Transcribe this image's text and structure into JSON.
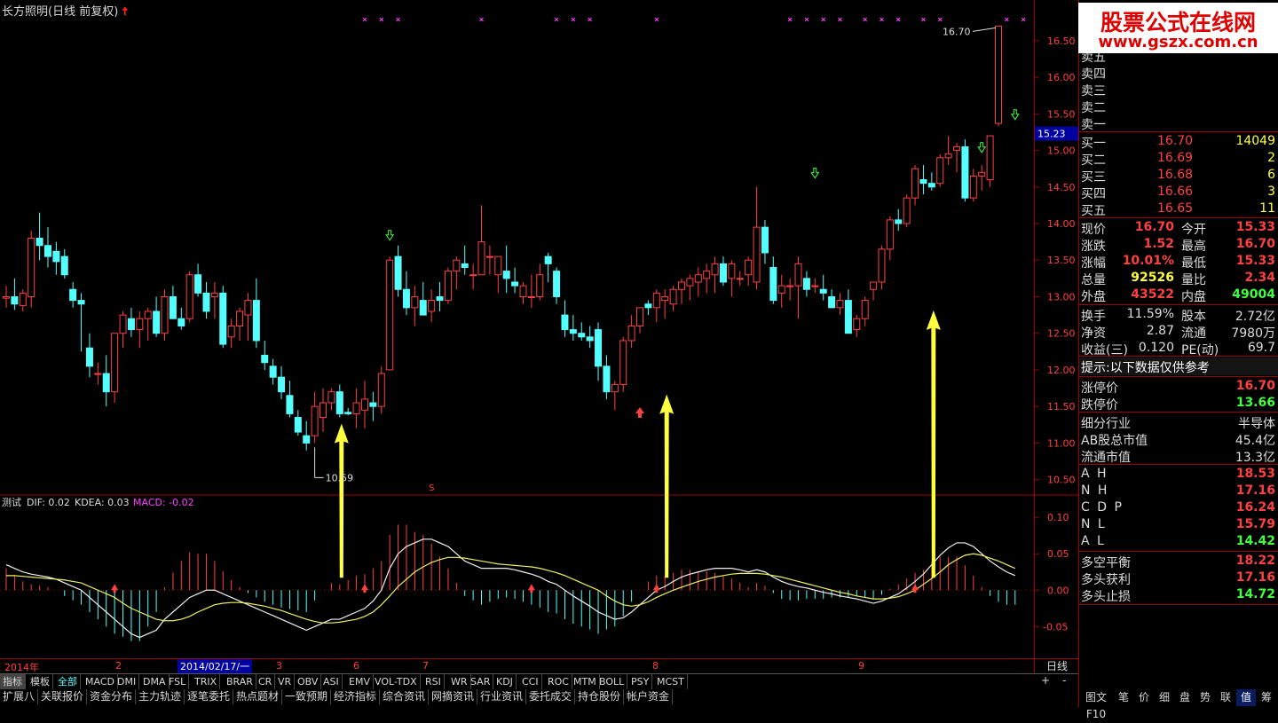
{
  "window_title": "长方照明(日线 前复权)",
  "price_axis": {
    "labels": [
      "16.50",
      "16.00",
      "15.50",
      "15.00",
      "14.50",
      "14.00",
      "13.50",
      "13.00",
      "12.50",
      "12.00",
      "11.50",
      "11.00",
      "10.50"
    ],
    "current_price_tag": "15.23",
    "high_label": "16.70",
    "low_label": "10.59",
    "s_marker": "S"
  },
  "indicator": {
    "name": "测试",
    "dif_text": "DIF: 0.02",
    "kdea_text": "KDEA: 0.03",
    "macd_text": "MACD: -0.02",
    "axis_labels": [
      "0.10",
      "0.05",
      "0.00",
      "-0.05"
    ]
  },
  "time_axis": {
    "labels": [
      "2014年",
      "2",
      "2014/02/17/一",
      "3",
      "6",
      "7",
      "8",
      "9"
    ],
    "period": "日线",
    "plus": "+",
    "minus": "-"
  },
  "chart_data": {
    "type": "candlestick",
    "ylim": [
      10.35,
      16.85
    ],
    "candles": [
      [
        12.98,
        13.15,
        12.85,
        13.0
      ],
      [
        13.0,
        13.25,
        12.82,
        12.9
      ],
      [
        12.88,
        13.1,
        12.8,
        13.05
      ],
      [
        13.0,
        13.9,
        12.85,
        13.8
      ],
      [
        13.8,
        14.15,
        13.5,
        13.7
      ],
      [
        13.7,
        13.95,
        13.4,
        13.55
      ],
      [
        13.62,
        13.75,
        13.3,
        13.48
      ],
      [
        13.55,
        13.65,
        13.25,
        13.3
      ],
      [
        13.1,
        13.2,
        12.85,
        12.95
      ],
      [
        12.95,
        13.05,
        12.25,
        12.9
      ],
      [
        12.3,
        12.5,
        11.9,
        12.05
      ],
      [
        11.95,
        12.1,
        11.8,
        11.95
      ],
      [
        11.95,
        12.2,
        11.5,
        11.7
      ],
      [
        11.7,
        12.2,
        11.55,
        12.5
      ],
      [
        12.5,
        12.8,
        12.3,
        12.75
      ],
      [
        12.7,
        12.85,
        12.45,
        12.55
      ],
      [
        12.55,
        12.8,
        12.3,
        12.7
      ],
      [
        12.7,
        12.85,
        12.4,
        12.8
      ],
      [
        12.8,
        13.0,
        12.45,
        12.5
      ],
      [
        12.5,
        13.1,
        12.4,
        13.0
      ],
      [
        13.0,
        13.15,
        12.75,
        12.7
      ],
      [
        12.7,
        12.85,
        12.55,
        12.6
      ],
      [
        12.7,
        13.35,
        12.65,
        13.3
      ],
      [
        13.3,
        13.45,
        13.0,
        13.05
      ],
      [
        13.05,
        13.2,
        12.7,
        12.8
      ],
      [
        13.0,
        13.2,
        12.7,
        13.05
      ],
      [
        13.05,
        13.15,
        12.3,
        12.35
      ],
      [
        12.45,
        12.7,
        12.3,
        12.6
      ],
      [
        12.6,
        12.85,
        12.4,
        12.8
      ],
      [
        12.75,
        13.05,
        12.4,
        12.95
      ],
      [
        12.95,
        13.25,
        12.3,
        12.4
      ],
      [
        12.2,
        12.4,
        12.0,
        12.1
      ],
      [
        12.05,
        12.15,
        11.8,
        11.9
      ],
      [
        11.9,
        12.05,
        11.6,
        11.7
      ],
      [
        11.65,
        11.85,
        11.35,
        11.4
      ],
      [
        11.35,
        11.45,
        11.1,
        11.15
      ],
      [
        11.1,
        11.3,
        10.9,
        11.0
      ],
      [
        11.1,
        11.7,
        11.0,
        11.5
      ],
      [
        11.35,
        11.75,
        11.15,
        11.55
      ],
      [
        11.55,
        11.75,
        11.45,
        11.7
      ],
      [
        11.7,
        11.8,
        11.35,
        11.4
      ],
      [
        11.42,
        11.48,
        11.38,
        11.4
      ],
      [
        11.4,
        11.75,
        11.2,
        11.55
      ],
      [
        11.45,
        11.85,
        11.2,
        11.6
      ],
      [
        11.55,
        11.7,
        11.3,
        11.5
      ],
      [
        11.5,
        12.05,
        11.4,
        11.95
      ],
      [
        12.0,
        13.55,
        12.0,
        13.5
      ],
      [
        13.55,
        13.7,
        13.0,
        13.1
      ],
      [
        13.1,
        13.35,
        12.75,
        12.85
      ],
      [
        12.85,
        13.15,
        12.6,
        13.0
      ],
      [
        12.95,
        13.2,
        12.75,
        12.75
      ],
      [
        12.8,
        13.1,
        12.65,
        12.95
      ],
      [
        13.0,
        13.2,
        12.8,
        12.95
      ],
      [
        12.95,
        13.4,
        12.9,
        13.35
      ],
      [
        13.35,
        13.55,
        13.1,
        13.5
      ],
      [
        13.45,
        13.7,
        13.3,
        13.4
      ],
      [
        13.3,
        13.45,
        13.1,
        13.3
      ],
      [
        13.3,
        14.25,
        13.3,
        13.75
      ],
      [
        13.55,
        13.7,
        13.3,
        13.55
      ],
      [
        13.3,
        13.55,
        13.05,
        13.55
      ],
      [
        13.35,
        13.7,
        13.05,
        13.25
      ],
      [
        13.2,
        13.4,
        13.05,
        13.15
      ],
      [
        13.0,
        13.2,
        12.9,
        13.15
      ],
      [
        13.0,
        13.3,
        12.85,
        13.0
      ],
      [
        13.0,
        13.45,
        12.95,
        13.3
      ],
      [
        13.55,
        13.6,
        13.2,
        13.45
      ],
      [
        13.35,
        13.4,
        12.9,
        13.0
      ],
      [
        12.75,
        12.95,
        12.45,
        12.55
      ],
      [
        12.55,
        12.75,
        12.4,
        12.5
      ],
      [
        12.5,
        12.65,
        12.4,
        12.45
      ],
      [
        12.45,
        12.6,
        12.3,
        12.4
      ],
      [
        12.55,
        12.65,
        11.85,
        12.05
      ],
      [
        12.05,
        12.2,
        11.6,
        11.7
      ],
      [
        11.7,
        11.85,
        11.45,
        11.8
      ],
      [
        11.8,
        12.45,
        11.7,
        12.4
      ],
      [
        12.4,
        12.75,
        12.3,
        12.6
      ],
      [
        12.6,
        12.85,
        12.5,
        12.85
      ],
      [
        12.9,
        12.95,
        12.75,
        12.85
      ],
      [
        12.85,
        13.1,
        12.65,
        13.05
      ],
      [
        12.95,
        13.1,
        12.7,
        13.0
      ],
      [
        12.9,
        13.15,
        12.8,
        13.1
      ],
      [
        13.1,
        13.25,
        12.9,
        13.2
      ],
      [
        13.15,
        13.3,
        12.95,
        13.25
      ],
      [
        13.2,
        13.4,
        13.0,
        13.3
      ],
      [
        13.25,
        13.45,
        13.05,
        13.35
      ],
      [
        13.3,
        13.55,
        13.05,
        13.45
      ],
      [
        13.45,
        13.55,
        13.15,
        13.2
      ],
      [
        13.25,
        13.5,
        13.0,
        13.45
      ],
      [
        13.25,
        13.35,
        13.15,
        13.25
      ],
      [
        13.3,
        13.55,
        13.15,
        13.5
      ],
      [
        13.2,
        14.5,
        13.1,
        13.95
      ],
      [
        13.95,
        14.05,
        13.45,
        13.6
      ],
      [
        13.4,
        13.55,
        12.9,
        12.95
      ],
      [
        13.05,
        13.3,
        12.85,
        13.15
      ],
      [
        13.15,
        13.25,
        12.95,
        13.15
      ],
      [
        13.15,
        13.55,
        12.7,
        13.45
      ],
      [
        13.25,
        13.35,
        13.0,
        13.1
      ],
      [
        13.15,
        13.25,
        13.05,
        13.15
      ],
      [
        13.1,
        13.3,
        12.95,
        13.05
      ],
      [
        13.0,
        13.1,
        12.85,
        12.85
      ],
      [
        12.85,
        13.05,
        12.75,
        12.95
      ],
      [
        12.95,
        13.1,
        12.5,
        12.5
      ],
      [
        12.55,
        12.75,
        12.45,
        12.7
      ],
      [
        12.7,
        13.0,
        12.6,
        12.95
      ],
      [
        13.1,
        13.2,
        12.95,
        13.2
      ],
      [
        13.2,
        13.7,
        13.1,
        13.65
      ],
      [
        13.65,
        14.1,
        13.5,
        14.05
      ],
      [
        14.05,
        14.2,
        13.9,
        14.0
      ],
      [
        14.0,
        14.4,
        13.95,
        14.35
      ],
      [
        14.35,
        14.8,
        14.25,
        14.75
      ],
      [
        14.6,
        14.8,
        14.4,
        14.55
      ],
      [
        14.55,
        14.7,
        14.45,
        14.5
      ],
      [
        14.55,
        14.95,
        14.5,
        14.9
      ],
      [
        14.9,
        15.2,
        14.8,
        14.95
      ],
      [
        15.0,
        15.1,
        14.7,
        15.05
      ],
      [
        15.05,
        15.15,
        14.3,
        14.35
      ],
      [
        14.35,
        14.75,
        14.3,
        14.65
      ],
      [
        14.65,
        14.8,
        14.45,
        14.7
      ],
      [
        14.6,
        15.2,
        14.5,
        15.2
      ],
      [
        15.37,
        16.7,
        15.33,
        16.7
      ]
    ],
    "dif": [
      0.035,
      0.03,
      0.025,
      0.022,
      0.02,
      0.018,
      0.015,
      0.01,
      0.005,
      0.0,
      -0.01,
      -0.02,
      -0.03,
      -0.04,
      -0.05,
      -0.06,
      -0.065,
      -0.06,
      -0.055,
      -0.04,
      -0.03,
      -0.02,
      -0.01,
      -0.005,
      0.0,
      0.0,
      -0.005,
      -0.01,
      -0.015,
      -0.02,
      -0.025,
      -0.03,
      -0.035,
      -0.04,
      -0.045,
      -0.05,
      -0.055,
      -0.05,
      -0.045,
      -0.04,
      -0.04,
      -0.035,
      -0.03,
      -0.025,
      -0.015,
      0.0,
      0.03,
      0.05,
      0.06,
      0.065,
      0.07,
      0.07,
      0.065,
      0.06,
      0.05,
      0.04,
      0.035,
      0.03,
      0.03,
      0.03,
      0.03,
      0.028,
      0.025,
      0.022,
      0.018,
      0.012,
      0.008,
      0.0,
      -0.008,
      -0.015,
      -0.022,
      -0.03,
      -0.035,
      -0.04,
      -0.038,
      -0.03,
      -0.02,
      -0.01,
      0.0,
      0.005,
      0.012,
      0.018,
      0.022,
      0.025,
      0.028,
      0.03,
      0.03,
      0.03,
      0.028,
      0.025,
      0.028,
      0.025,
      0.018,
      0.012,
      0.008,
      0.005,
      0.003,
      0.0,
      -0.003,
      -0.005,
      -0.008,
      -0.01,
      -0.012,
      -0.015,
      -0.018,
      -0.015,
      -0.01,
      -0.005,
      0.003,
      0.012,
      0.022,
      0.035,
      0.048,
      0.058,
      0.065,
      0.065,
      0.06,
      0.05,
      0.04,
      0.032,
      0.025,
      0.02
    ],
    "kdea": [
      0.02,
      0.02,
      0.019,
      0.018,
      0.017,
      0.016,
      0.015,
      0.014,
      0.012,
      0.01,
      0.005,
      0.0,
      -0.005,
      -0.01,
      -0.018,
      -0.025,
      -0.03,
      -0.035,
      -0.04,
      -0.042,
      -0.042,
      -0.04,
      -0.036,
      -0.03,
      -0.025,
      -0.02,
      -0.018,
      -0.017,
      -0.017,
      -0.018,
      -0.02,
      -0.022,
      -0.025,
      -0.028,
      -0.032,
      -0.036,
      -0.04,
      -0.043,
      -0.045,
      -0.045,
      -0.044,
      -0.042,
      -0.04,
      -0.036,
      -0.03,
      -0.02,
      -0.008,
      0.005,
      0.015,
      0.025,
      0.032,
      0.038,
      0.042,
      0.045,
      0.045,
      0.044,
      0.042,
      0.04,
      0.038,
      0.036,
      0.035,
      0.034,
      0.033,
      0.032,
      0.03,
      0.027,
      0.024,
      0.02,
      0.015,
      0.01,
      0.005,
      0.0,
      -0.008,
      -0.015,
      -0.02,
      -0.022,
      -0.02,
      -0.016,
      -0.01,
      -0.005,
      0.0,
      0.004,
      0.008,
      0.012,
      0.015,
      0.018,
      0.02,
      0.022,
      0.023,
      0.023,
      0.023,
      0.022,
      0.02,
      0.018,
      0.015,
      0.012,
      0.009,
      0.006,
      0.003,
      0.0,
      -0.003,
      -0.005,
      -0.008,
      -0.01,
      -0.012,
      -0.012,
      -0.011,
      -0.009,
      -0.005,
      0.0,
      0.008,
      0.016,
      0.025,
      0.035,
      0.042,
      0.048,
      0.05,
      0.048,
      0.044,
      0.04,
      0.035,
      0.03
    ]
  },
  "order_book": {
    "sell": [
      {
        "label": "卖五"
      },
      {
        "label": "卖四"
      },
      {
        "label": "卖三"
      },
      {
        "label": "卖二"
      },
      {
        "label": "卖一"
      }
    ],
    "buy": [
      {
        "label": "买一",
        "price": "16.70",
        "vol": "14049"
      },
      {
        "label": "买二",
        "price": "16.69",
        "vol": "2"
      },
      {
        "label": "买三",
        "price": "16.68",
        "vol": "6"
      },
      {
        "label": "买四",
        "price": "16.66",
        "vol": "3"
      },
      {
        "label": "买五",
        "price": "16.65",
        "vol": "11"
      }
    ]
  },
  "quote": {
    "rows": [
      {
        "l1": "现价",
        "v1": "16.70",
        "l2": "今开",
        "v2": "15.33"
      },
      {
        "l1": "涨跌",
        "v1": "1.52",
        "l2": "最高",
        "v2": "16.70"
      },
      {
        "l1": "涨幅",
        "v1": "10.01%",
        "l2": "最低",
        "v2": "15.33"
      },
      {
        "l1": "总量",
        "v1": "92526",
        "l2": "量比",
        "v2": "2.34"
      },
      {
        "l1": "外盘",
        "v1": "43522",
        "l2": "内盘",
        "v2": "49004"
      }
    ],
    "rows2": [
      {
        "l1": "换手",
        "v1": "11.59%",
        "l2": "股本",
        "v2": "2.72亿"
      },
      {
        "l1": "净资",
        "v1": "2.87",
        "l2": "流通",
        "v2": "7980万"
      },
      {
        "l1": "收益(三)",
        "v1": "0.120",
        "l2": "PE(动)",
        "v2": "69.7"
      }
    ],
    "tip": "提示:以下数据仅供参考",
    "limit_up_label": "涨停价",
    "limit_up": "16.70",
    "limit_down_label": "跌停价",
    "limit_down": "13.66",
    "industry_label": "细分行业",
    "industry": "半导体",
    "ab_cap_label": "AB股总市值",
    "ab_cap": "45.4亿",
    "float_cap_label": "流通市值",
    "float_cap": "13.3亿"
  },
  "levels": [
    {
      "label": "A H",
      "value": "18.53"
    },
    {
      "label": "N H",
      "value": "17.16"
    },
    {
      "label": "C D P",
      "value": "16.24"
    },
    {
      "label": "N L",
      "value": "15.79"
    },
    {
      "label": "A L",
      "value": "14.42"
    }
  ],
  "balance": [
    {
      "label": "多空平衡",
      "value": "18.22"
    },
    {
      "label": "多头获利",
      "value": "17.16"
    },
    {
      "label": "多头止损",
      "value": "14.72"
    }
  ],
  "watermark": {
    "line1": "股票公式在线网",
    "line2": "www.gszx.com.cn"
  },
  "tabs_row1": [
    "指标",
    "模板",
    "全部",
    "MACD",
    "DMI",
    "DMA",
    "FSL",
    "TRIX",
    "BRAR",
    "CR",
    "VR",
    "OBV",
    "ASI",
    "EMV",
    "VOL-TDX",
    "RSI",
    "WR",
    "SAR",
    "KDJ",
    "CCI",
    "ROC",
    "MTM",
    "BOLL",
    "PSY",
    "MCST"
  ],
  "tabs_row2": [
    "扩展八",
    "关联报价",
    "资金分布",
    "主力轨迹",
    "逐笔委托",
    "热点题材",
    "一致预期",
    "经济指标",
    "综合资讯",
    "网摘资讯",
    "行业资讯",
    "委托成交",
    "持仓股份",
    "帐户资金"
  ],
  "bottom_right_tabs": [
    "图文F10",
    "笔",
    "价",
    "细",
    "盘",
    "势",
    "联",
    "值",
    "筹"
  ],
  "colors": {
    "up": "#ff4040",
    "down": "#54ffff",
    "yellow": "#ffff40",
    "magenta": "#ff40ff",
    "green": "#40ff40",
    "accent": "#a00000"
  }
}
